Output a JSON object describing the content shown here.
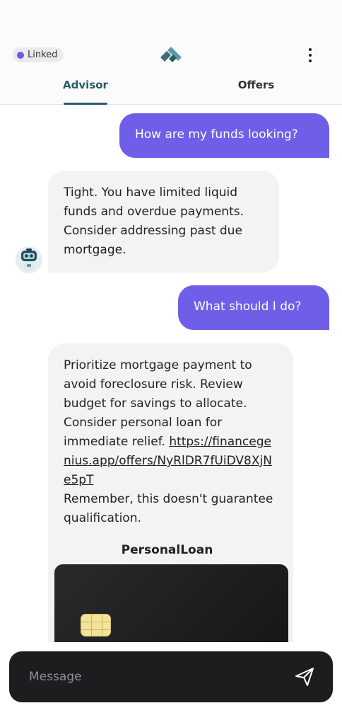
{
  "header": {
    "linked_label": "Linked",
    "logo_icon": "chevron-stack-logo",
    "menu_icon": "more-vertical-icon",
    "tabs": [
      {
        "label": "Advisor",
        "active": true
      },
      {
        "label": "Offers",
        "active": false
      }
    ]
  },
  "messages": [
    {
      "role": "user",
      "text": "How are my funds looking?"
    },
    {
      "role": "bot",
      "text": "Tight. You have limited liquid funds and overdue payments. Consider addressing past due mortgage."
    },
    {
      "role": "user",
      "text": "What should I do?"
    },
    {
      "role": "bot",
      "text_before_link": "Prioritize mortgage payment to avoid foreclosure risk. Review budget for savings to allocate. Consider personal loan for immediate relief. ",
      "link": "https://financegenius.app/offers/NyRlDR7fUiDV8XjNe5pT",
      "text_after_link": "Remember, this doesn't guarantee qualification.",
      "offer_title": "PersonalLoan"
    }
  ],
  "composer": {
    "placeholder": "Message",
    "send_icon": "send-icon"
  },
  "colors": {
    "accent": "#6f5ee8",
    "linked_dot": "#6c5ce7",
    "tab_active": "#2c5a68",
    "bot_bubble": "#f3f3f5",
    "composer_bg": "#1d1d20"
  }
}
